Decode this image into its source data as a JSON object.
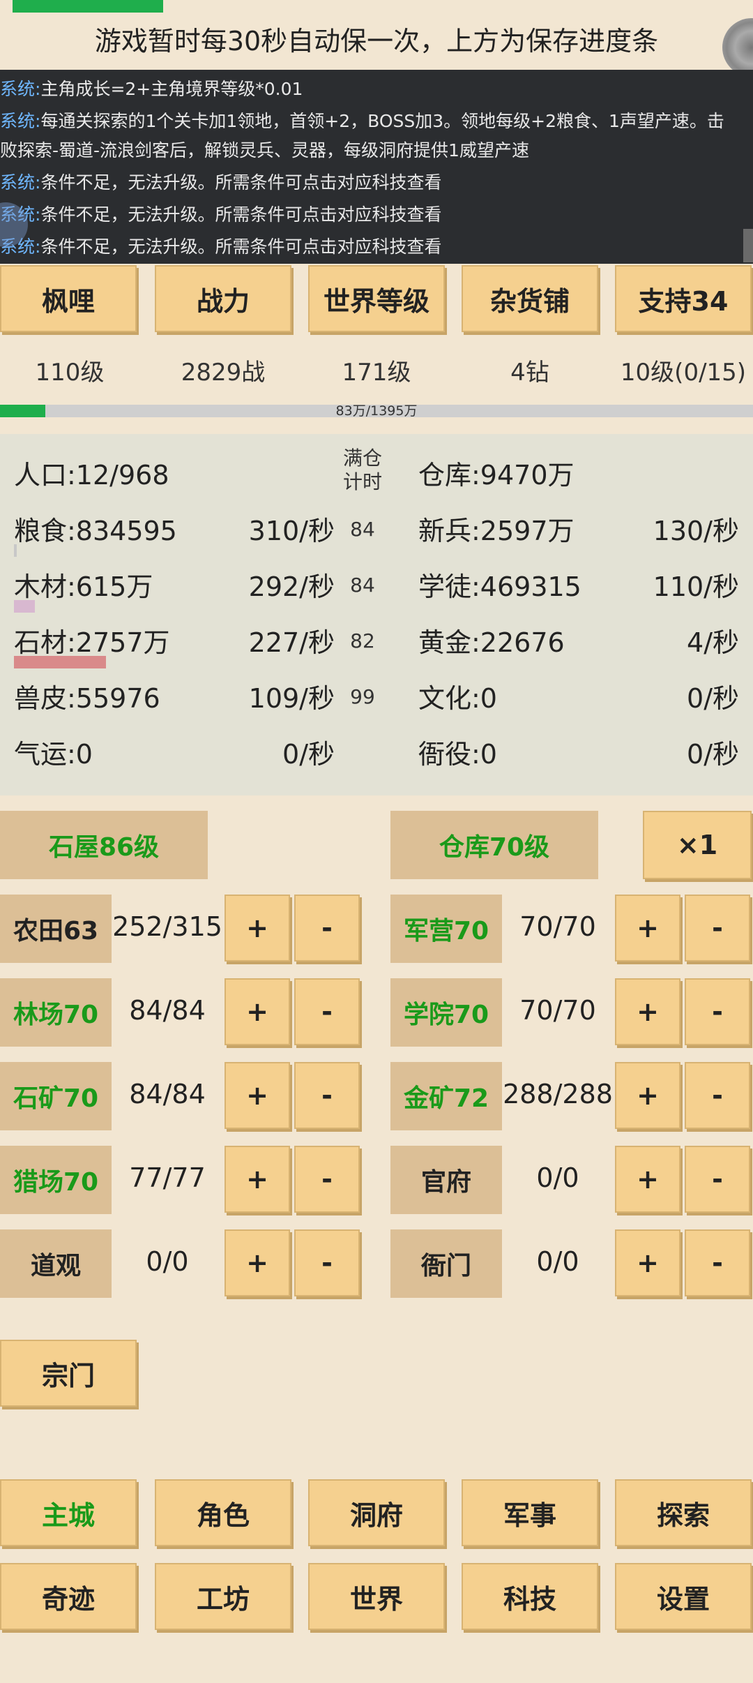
{
  "header": {
    "save_hint": "游戏暂时每30秒自动保一次，上方为保存进度条",
    "save_progress": 0.2
  },
  "log": {
    "lines": [
      {
        "tag": "系统:",
        "text": "主角成长=2+主角境界等级*0.01"
      },
      {
        "tag": "系统:",
        "text": "每通关探索的1个关卡加1领地，首领+2，BOSS加3。领地每级+2粮食、1声望产速。击"
      },
      {
        "tag": "",
        "text": "败探索-蜀道-流浪剑客后，解锁灵兵、灵器，每级洞府提供1威望产速"
      },
      {
        "tag": "系统:",
        "text": "条件不足，无法升级。所需条件可点击对应科技查看"
      },
      {
        "tag": "系统:",
        "text": "条件不足，无法升级。所需条件可点击对应科技查看"
      },
      {
        "tag": "系统:",
        "text": "条件不足，无法升级。所需条件可点击对应科技查看"
      }
    ]
  },
  "top_tabs": [
    {
      "label": "枫哩",
      "value": "110级"
    },
    {
      "label": "战力",
      "value": "2829战"
    },
    {
      "label": "世界等级",
      "value": "171级"
    },
    {
      "label": "杂货铺",
      "value": "4钻"
    },
    {
      "label": "支持34",
      "value": "10级(0/15)"
    }
  ],
  "xp": {
    "text": "83万/1395万",
    "fraction": 0.06
  },
  "resources": {
    "full_header": "满仓\n计时",
    "population": "人口:12/968",
    "warehouse": "仓库:9470万",
    "left": [
      {
        "label": "粮食:834595",
        "rate": "310/秒",
        "full": "84"
      },
      {
        "label": "木材:615万",
        "rate": "292/秒",
        "full": "84"
      },
      {
        "label": "石材:2757万",
        "rate": "227/秒",
        "full": "82"
      },
      {
        "label": "兽皮:55976",
        "rate": "109/秒",
        "full": "99"
      },
      {
        "label": "气运:0",
        "rate": "0/秒",
        "full": ""
      }
    ],
    "right": [
      {
        "label": "新兵:2597万",
        "rate": "130/秒"
      },
      {
        "label": "学徒:469315",
        "rate": "110/秒"
      },
      {
        "label": "黄金:22676",
        "rate": "4/秒"
      },
      {
        "label": "文化:0",
        "rate": "0/秒"
      },
      {
        "label": "衙役:0",
        "rate": "0/秒"
      }
    ],
    "bar_colors": {
      "grain": "#c8c8c8",
      "wood": "#d8b8d0",
      "stone": "#d98a8a"
    }
  },
  "buildings": {
    "house": "石屋86级",
    "storage": "仓库70级",
    "multiplier": "×1",
    "plus": "+",
    "minus": "-",
    "left": [
      {
        "name": "农田63",
        "count": "252/315",
        "green": false
      },
      {
        "name": "林场70",
        "count": "84/84",
        "green": true
      },
      {
        "name": "石矿70",
        "count": "84/84",
        "green": true
      },
      {
        "name": "猎场70",
        "count": "77/77",
        "green": true
      },
      {
        "name": "道观",
        "count": "0/0",
        "green": false
      }
    ],
    "right": [
      {
        "name": "军营70",
        "count": "70/70",
        "green": true
      },
      {
        "name": "学院70",
        "count": "70/70",
        "green": true
      },
      {
        "name": "金矿72",
        "count": "288/288",
        "green": true
      },
      {
        "name": "官府",
        "count": "0/0",
        "green": false
      },
      {
        "name": "衙门",
        "count": "0/0",
        "green": false
      }
    ],
    "sect": "宗门"
  },
  "bottom_nav": {
    "row1": [
      "主城",
      "角色",
      "洞府",
      "军事",
      "探索"
    ],
    "row2": [
      "奇迹",
      "工坊",
      "世界",
      "科技",
      "设置"
    ]
  }
}
